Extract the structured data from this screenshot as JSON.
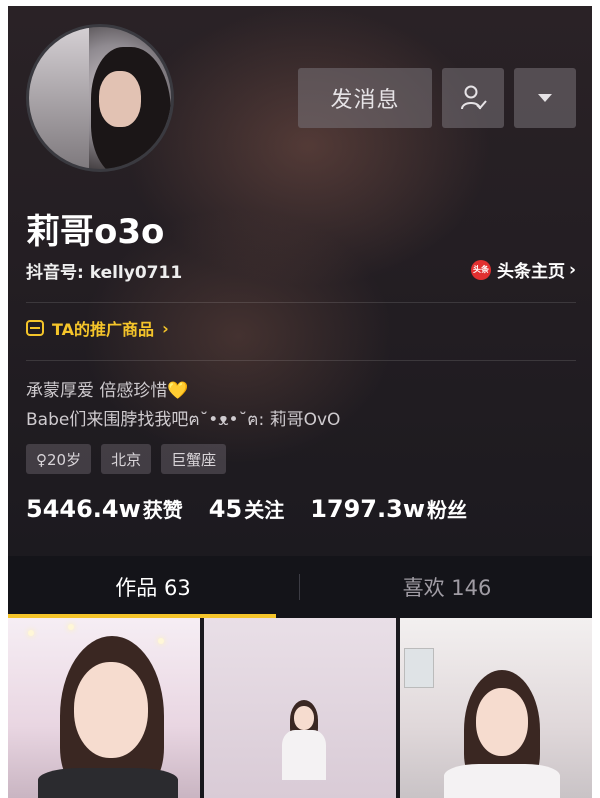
{
  "profile": {
    "nickname": "莉哥o3o",
    "douyin_id": "抖音号: kelly0711",
    "toutiao_badge": "头条",
    "toutiao_link": "头条主页",
    "promo": "TA的推广商品",
    "bio_line1": "承蒙厚爱 倍感珍惜💛",
    "bio_line2": "Babe们来围脖找我吧ฅ˘•ᴥ•˘ฅ: 莉哥OvO",
    "tags": [
      "♀20岁",
      "北京",
      "巨蟹座"
    ]
  },
  "actions": {
    "message_label": "发消息",
    "follow_icon": "user-check-icon",
    "more_icon": "caret-down-icon"
  },
  "stats": {
    "likes_num": "5446.4w",
    "likes_label": "获赞",
    "following_num": "45",
    "following_label": "关注",
    "followers_num": "1797.3w",
    "followers_label": "粉丝"
  },
  "tabs": {
    "works": "作品 63",
    "likes": "喜欢 146"
  },
  "colors": {
    "accent": "#f5c52a",
    "toutiao_red": "#e13030",
    "background": "#1c1a1f"
  }
}
